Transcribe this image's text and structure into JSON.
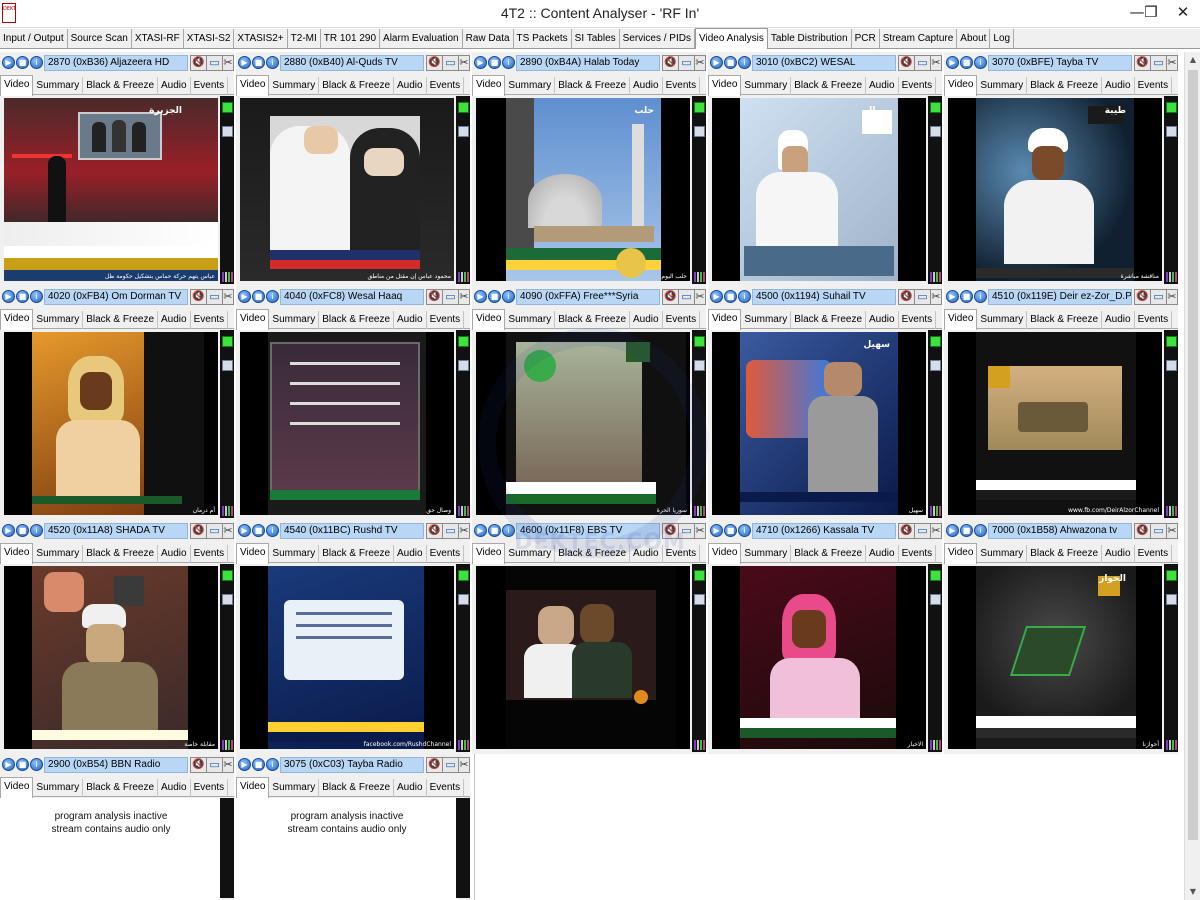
{
  "window": {
    "title": "4T2 :: Content Analyser - 'RF In'",
    "app_icon_text": "DEKTEC",
    "minimize_glyph": "—",
    "restore_glyph": "❒",
    "close_glyph": "✕"
  },
  "menu_tabs": [
    "Input / Output",
    "Source Scan",
    "XTASI-RF",
    "XTASI-S2",
    "XTASIS2+",
    "T2-MI",
    "TR 101 290",
    "Alarm Evaluation",
    "Raw Data",
    "TS Packets",
    "SI Tables",
    "Services / PIDs",
    "Video Analysis",
    "Table Distribution",
    "PCR",
    "Stream Capture",
    "About",
    "Log"
  ],
  "active_menu_tab": "Video Analysis",
  "pane_tabs": [
    "Video",
    "Summary",
    "Black & Freeze",
    "Audio",
    "Events"
  ],
  "active_pane_tab": "Video",
  "audio_only_message": {
    "line1": "program analysis inactive",
    "line2": "stream contains audio only"
  },
  "watermark_text": "DEKTEC.COM",
  "services": [
    {
      "title": "2870 (0xB36) Aljazeera HD",
      "ticker": "عباس يتهم حركة حماس بتشكيل حكومة ظل",
      "logo": "الجزيرة",
      "scene": "news"
    },
    {
      "title": "2880 (0xB40) Al-Quds TV",
      "ticker": "محمود عباس إن مقتل من مناطق",
      "logo": "",
      "scene": "lab"
    },
    {
      "title": "2890 (0xB4A) Halab Today",
      "ticker": "حلب اليوم",
      "logo": "حلب",
      "scene": "mosque"
    },
    {
      "title": "3010 (0xBC2) WESAL",
      "ticker": "",
      "logo": "وصال",
      "scene": "sheikh_studio"
    },
    {
      "title": "3070 (0xBFE) Tayba TV",
      "ticker": "مناقشة مباشرة",
      "logo": "طيبة",
      "scene": "sheikh_globe"
    },
    {
      "title": "4020 (0xFB4) Om Dorman TV",
      "ticker": "أم درمان",
      "logo": "",
      "scene": "woman_orange"
    },
    {
      "title": "4040 (0xFC8) Wesal Haaq",
      "ticker": "وصال حق",
      "logo": "",
      "scene": "poster"
    },
    {
      "title": "4090 (0xFFA) Free***Syria",
      "ticker": "سوريا الحرة",
      "logo": "",
      "scene": "syria"
    },
    {
      "title": "4500 (0x1194) Suhail TV",
      "ticker": "سهيل",
      "logo": "سهيل",
      "scene": "anchor_map"
    },
    {
      "title": "4510 (0x119E) Deir ez-Zor_D.P.N",
      "ticker": "www.fb.com/DeirAlzorChannel",
      "logo": "",
      "scene": "tank"
    },
    {
      "title": "4520 (0x11A8) SHADA TV",
      "ticker": "مقابلة خاصة",
      "logo": "",
      "scene": "elder"
    },
    {
      "title": "4540 (0x11BC) Rushd TV",
      "ticker": "facebook.com/RushdChannel",
      "logo": "",
      "scene": "card"
    },
    {
      "title": "4600 (0x11F8) EBS TV",
      "ticker": "",
      "logo": "",
      "scene": "party"
    },
    {
      "title": "4710 (0x1266) Kassala TV",
      "ticker": "الاخبار",
      "logo": "",
      "scene": "woman_pink"
    },
    {
      "title": "7000 (0x1B58) Ahwazona tv",
      "ticker": "أحوازنا",
      "logo": "الحواز",
      "scene": "logo3d"
    },
    {
      "title": "2900 (0xB54) BBN Radio",
      "ticker": "",
      "logo": "",
      "scene": "audio"
    },
    {
      "title": "3075 (0xC03) Tayba Radio",
      "ticker": "",
      "logo": "",
      "scene": "audio"
    }
  ],
  "icons": {
    "control_1": "play-icon",
    "control_2": "stop-icon",
    "control_3": "info-icon",
    "speaker": "mute-speaker-icon",
    "monitor": "monitor-icon",
    "tools": "tools-icon"
  },
  "colors": {
    "title_bg": "#b9d7f5",
    "status_green": "#3fe03f",
    "control_blue": "#1f63c2"
  }
}
